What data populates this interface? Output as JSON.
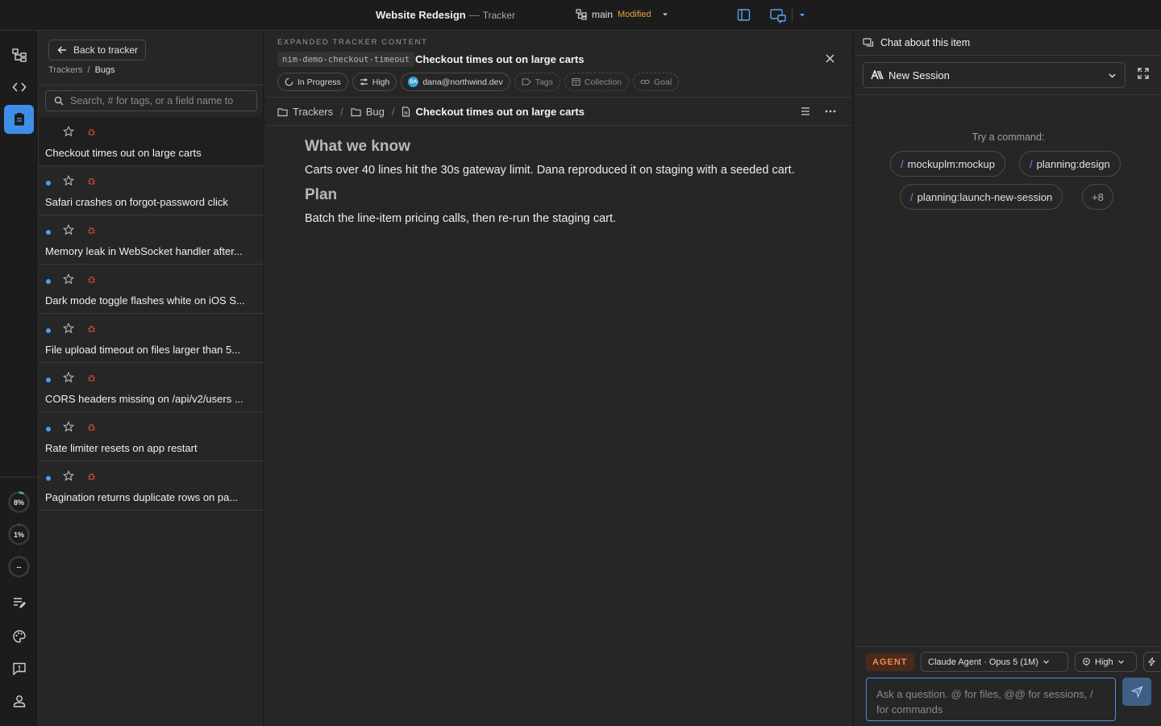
{
  "titlebar": {
    "project": "Website Redesign",
    "separator": "—",
    "view": "Tracker",
    "branch": "main",
    "branch_status": "Modified"
  },
  "rail": {
    "gauges": [
      {
        "label": "8%",
        "fraction": 0.08
      },
      {
        "label": "1%",
        "fraction": 0.01
      },
      {
        "label": "--",
        "fraction": 0
      }
    ]
  },
  "list": {
    "back_label": "Back to tracker",
    "breadcrumb_root": "Trackers",
    "breadcrumb_sep": "/",
    "breadcrumb_current": "Bugs",
    "search_placeholder": "Search, # for tags, or a field name to",
    "items": [
      {
        "title": "Checkout times out on large carts",
        "unread": false,
        "selected": true
      },
      {
        "title": "Safari crashes on forgot-password click",
        "unread": true,
        "selected": false
      },
      {
        "title": "Memory leak in WebSocket handler after...",
        "unread": true,
        "selected": false
      },
      {
        "title": "Dark mode toggle flashes white on iOS S...",
        "unread": true,
        "selected": false
      },
      {
        "title": "File upload timeout on files larger than 5...",
        "unread": true,
        "selected": false
      },
      {
        "title": "CORS headers missing on /api/v2/users ...",
        "unread": true,
        "selected": false
      },
      {
        "title": "Rate limiter resets on app restart",
        "unread": true,
        "selected": false
      },
      {
        "title": "Pagination returns duplicate rows on pa...",
        "unread": true,
        "selected": false
      }
    ]
  },
  "detail": {
    "label": "EXPANDED TRACKER CONTENT",
    "slug": "nim-demo-checkout-timeout",
    "title": "Checkout times out on large carts",
    "chips": {
      "status": "In Progress",
      "priority": "High",
      "assignee": "dana@northwind.dev",
      "assignee_initials": "DA",
      "tags": "Tags",
      "collection": "Collection",
      "goal": "Goal"
    },
    "path": {
      "root": "Trackers",
      "folder": "Bug",
      "current": "Checkout times out on large carts",
      "sep": "/"
    },
    "sections": [
      {
        "heading": "What we know",
        "body": "Carts over 40 lines hit the 30s gateway limit. Dana reproduced it on staging with a seeded cart."
      },
      {
        "heading": "Plan",
        "body": "Batch the line-item pricing calls, then re-run the staging cart."
      }
    ]
  },
  "chat": {
    "header": "Chat about this item",
    "session": "New Session",
    "try_label": "Try a command:",
    "slash": "/",
    "commands": [
      "mockuplm:mockup",
      "planning:design",
      "planning:launch-new-session"
    ],
    "more": "+8",
    "agent_badge": "AGENT",
    "model": "Claude Agent · Opus 5 (1M)",
    "effort": "High",
    "input_placeholder": "Ask a question. @ for files, @@ for sessions, / for commands"
  },
  "colors": {
    "accent": "#3d8ee8",
    "modified": "#e8a23c",
    "bug": "#d94a3f",
    "agent": "#f08a4b",
    "unread_dot": "#4f9bff"
  }
}
